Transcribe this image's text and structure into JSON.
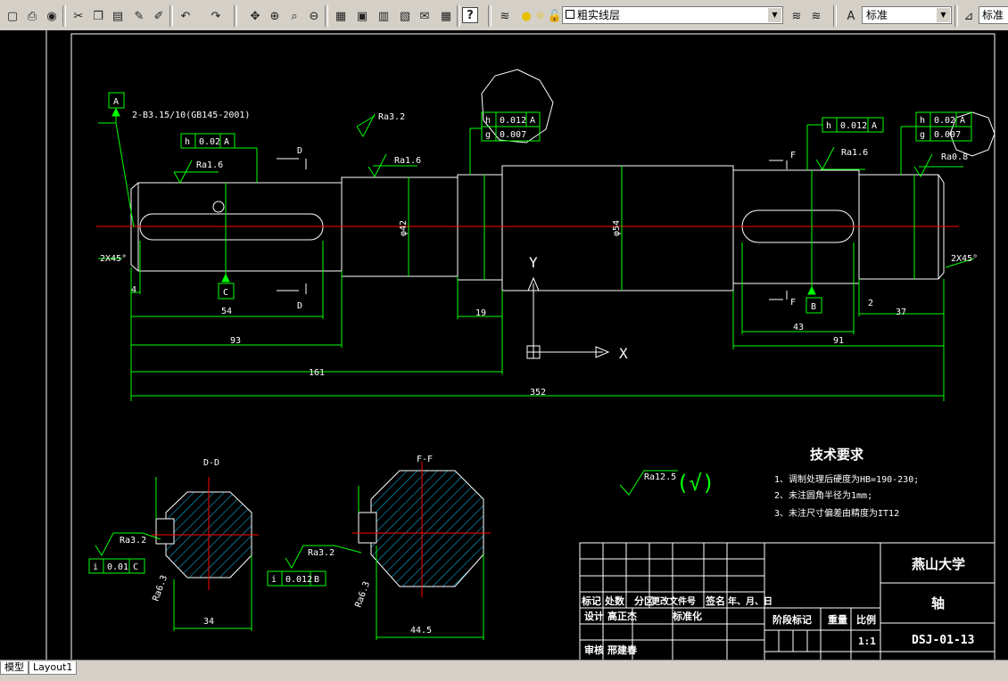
{
  "toolbar": {
    "layer_combo": "粗实线层",
    "text_style_combo": "标准",
    "dim_style_combo": "标准",
    "buttons": [
      "open-icon",
      "plot-icon",
      "preview-icon",
      "cut-icon",
      "copy-icon",
      "paste-icon",
      "matchprop-icon",
      "brush-icon",
      "undo-icon",
      "redo-icon",
      "pan-icon",
      "zoom-realtime-icon",
      "zoom-window-icon",
      "zoom-previous-icon",
      "properties-icon",
      "designcenter-icon",
      "toolpalette-icon",
      "sheetset-icon",
      "markup-icon",
      "calc-icon",
      "help-icon"
    ]
  },
  "tabs": {
    "model": "模型",
    "layout1": "Layout1"
  },
  "drawing": {
    "datum_a": "A",
    "datum_b": "B",
    "datum_c": "C",
    "center_hole_note": "2-B3.15/10(GB145-2001)",
    "section_d": "D",
    "section_f": "F",
    "chamfer_left": "2X45°",
    "chamfer_right": "2X45°",
    "ra16_left": "Ra1.6",
    "ra16_mid": "Ra1.6",
    "ra16_right": "Ra1.6",
    "ra32_top": "Ra3.2",
    "ra08": "Ra0.8",
    "h_tol_left": "h",
    "h_tol_left_val": "0.02",
    "h_tol_left_ref": "A",
    "h_tol_mid": "h",
    "h_tol_mid_val": "0.012",
    "h_tol_mid_ref": "A",
    "g_tol_mid": "g",
    "g_tol_mid_val": "0.007",
    "h_tol_r1": "h",
    "h_tol_r1_val": "0.012",
    "h_tol_r1_ref": "A",
    "h_tol_r2": "h",
    "h_tol_r2_val": "0.02",
    "h_tol_r2_ref": "A",
    "g_tol_r2": "g",
    "g_tol_r2_val": "0.007",
    "dim_4": "4",
    "dim_54": "54",
    "dim_93": "93",
    "dim_161": "161",
    "dim_19": "19",
    "dim_352": "352",
    "dim_43": "43",
    "dim_91": "91",
    "dim_37": "37",
    "dim_2": "2",
    "dim_phi42": "φ42",
    "dim_phi54": "φ54",
    "ucs_y": "Y",
    "ucs_x": "X",
    "section_dd_title": "D-D",
    "section_ff_title": "F-F",
    "ra32_dd": "Ra3.2",
    "ra32_ff": "Ra3.2",
    "ra63_dd": "Ra6.3",
    "ra63_ff": "Ra6.3",
    "i_tol_dd": "i",
    "i_tol_dd_val": "0.01",
    "i_tol_dd_ref": "C",
    "i_tol_ff": "i",
    "i_tol_ff_val": "0.012",
    "i_tol_ff_ref": "B",
    "dim_34": "34",
    "dim_44_5": "44.5",
    "ra125": "Ra12.5",
    "ra125_paren": "(√)",
    "tech_title": "技术要求",
    "tech_1": "1、调制处理后硬度为HB=190-230;",
    "tech_2": "2、未注圆角半径为1mm;",
    "tech_3": "3、未注尺寸偏差由精度为IT12"
  },
  "title_block": {
    "school": "燕山大学",
    "part": "轴",
    "drawing_no": "DSJ-01-13",
    "scale": "1:1",
    "h_mark": "标记",
    "h_count": "处数",
    "h_zone": "分区",
    "h_doc": "更改文件号",
    "h_sign": "签名",
    "h_date": "年、月、日",
    "design": "设计",
    "designer": "高正杰",
    "standard": "标准化",
    "check": "审核",
    "checker": "邢建春",
    "stage": "阶段标记",
    "weight": "重量",
    "ratio": "比例"
  }
}
